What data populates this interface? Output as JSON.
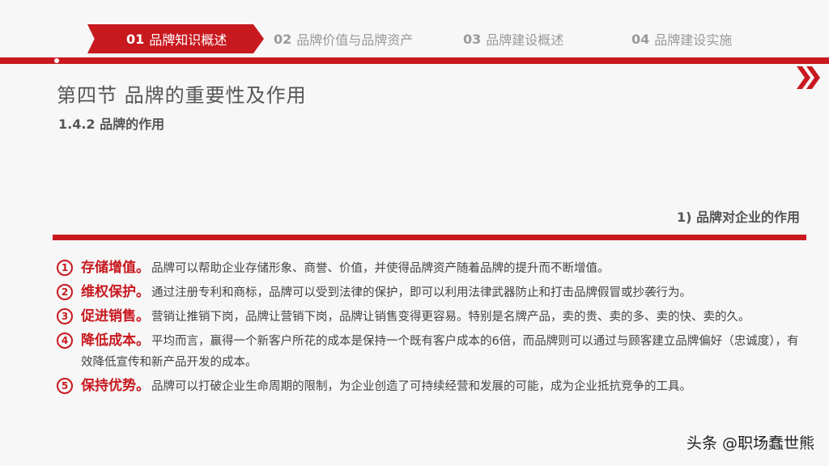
{
  "nav": {
    "tabs": [
      {
        "num": "01",
        "label": "品牌知识概述",
        "active": true
      },
      {
        "num": "02",
        "label": "品牌价值与品牌资产",
        "active": false
      },
      {
        "num": "03",
        "label": "品牌建设概述",
        "active": false
      },
      {
        "num": "04",
        "label": "品牌建设实施",
        "active": false
      }
    ]
  },
  "section_title": "第四节  品牌的重要性及作用",
  "subsection": "1.4.2 品牌的作用",
  "subtitle": "1) 品牌对企业的作用",
  "items": [
    {
      "marker": "1",
      "head": "存储增值。",
      "text": "品牌可以帮助企业存储形象、商誉、价值，并使得品牌资产随着品牌的提升而不断增值。"
    },
    {
      "marker": "2",
      "head": "维权保护。",
      "text": "通过注册专利和商标，品牌可以受到法律的保护，即可以利用法律武器防止和打击品牌假冒或抄袭行为。"
    },
    {
      "marker": "3",
      "head": "促进销售。",
      "text": "营销让推销下岗，品牌让营销下岗，品牌让销售变得更容易。特别是名牌产品，卖的贵、卖的多、卖的快、卖的久。"
    },
    {
      "marker": "4",
      "head": "降低成本。",
      "text": "平均而言，赢得一个新客户所花的成本是保持一个既有客户成本的6倍，而品牌则可以通过与顾客建立品牌偏好（忠诚度），有效降低宣传和新产品开发的成本。"
    },
    {
      "marker": "5",
      "head": "保持优势。",
      "text": "品牌可以打破企业生命周期的限制，为企业创造了可持续经营和发展的可能，成为企业抵抗竞争的工具。"
    }
  ],
  "watermark": "头条 @职场蠢世熊",
  "colors": {
    "accent": "#c8191f",
    "text": "#444444",
    "muted": "#9a9a9a"
  },
  "icons": {
    "next": "double-chevron-right-icon"
  }
}
